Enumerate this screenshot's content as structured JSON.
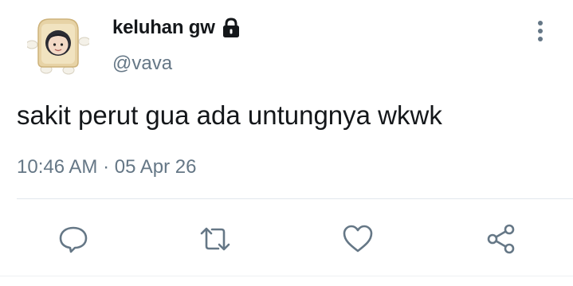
{
  "author": {
    "display_name": "keluhan gw",
    "handle": "@vava",
    "avatar_icon": "toast-frame-avatar",
    "lock_icon": "lock-icon"
  },
  "tweet": {
    "text": "sakit perut gua ada untungnya wkwk",
    "time": "10:46 AM",
    "separator": "·",
    "date": "05 Apr 26"
  },
  "actions": {
    "reply_icon": "reply-icon",
    "retweet_icon": "retweet-icon",
    "like_icon": "heart-icon",
    "share_icon": "share-icon"
  },
  "colors": {
    "primary_text": "#14171a",
    "secondary_text": "#657786",
    "icon": "#657786",
    "divider": "#e1e8ed"
  }
}
